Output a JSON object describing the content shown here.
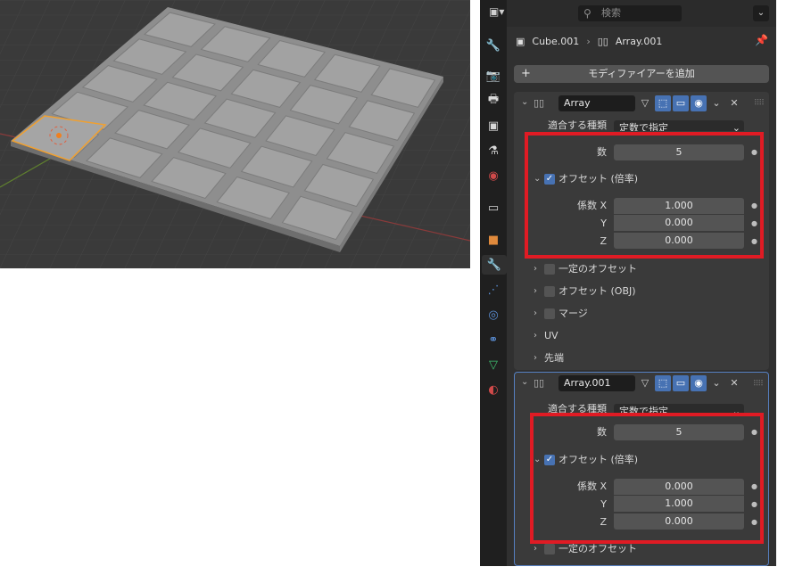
{
  "viewport": {
    "label": "3D Viewport"
  },
  "header": {
    "editor_icon": "properties-editor-icon",
    "search_placeholder": "検索",
    "menu_icon": "chevron-down-icon"
  },
  "breadcrumb": {
    "object": "Cube.001",
    "modifier": "Array.001"
  },
  "tabs": [
    "tool-icon",
    "render-icon",
    "output-icon",
    "view-layer-icon",
    "scene-icon",
    "world-icon",
    "collection-icon",
    "object-icon",
    "modifier-icon",
    "particles-icon",
    "physics-icon",
    "constraints-icon",
    "data-icon",
    "material-icon"
  ],
  "add_modifier": {
    "label": "モディファイアーを追加",
    "plus": "+"
  },
  "modifiers": [
    {
      "name": "Array",
      "fit_type_label": "適合する種類",
      "fit_type_value": "定数で指定",
      "count_label": "数",
      "count_value": "5",
      "relative_label": "オフセット (倍率)",
      "factor_x_label": "係数 X",
      "factor_x": "1.000",
      "factor_y_label": "Y",
      "factor_y": "0.000",
      "factor_z_label": "Z",
      "factor_z": "0.000",
      "constant_label": "一定のオフセット",
      "object_label": "オフセット (OBJ)",
      "merge_label": "マージ",
      "uv_label": "UV",
      "caps_label": "先端"
    },
    {
      "name": "Array.001",
      "fit_type_label": "適合する種類",
      "fit_type_value": "定数で指定",
      "count_label": "数",
      "count_value": "5",
      "relative_label": "オフセット (倍率)",
      "factor_x_label": "係数 X",
      "factor_x": "0.000",
      "factor_y_label": "Y",
      "factor_y": "1.000",
      "factor_z_label": "Z",
      "factor_z": "0.000",
      "constant_label": "一定のオフセット"
    }
  ],
  "colors": {
    "highlight": "#e01b24",
    "accent": "#4772b3",
    "panel": "#3a3a3a",
    "field": "#545454"
  }
}
